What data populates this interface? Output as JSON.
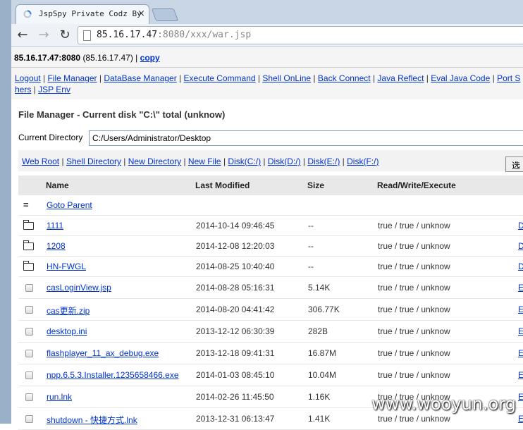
{
  "browser": {
    "tab_title": "JspSpy Private Codz By",
    "tab_close": "×",
    "url_host": "85.16.17.47",
    "url_rest": ":8080/xxx/war.jsp"
  },
  "header": {
    "host": "85.16.17.47:8080",
    "ip": "(85.16.17.47)",
    "sep": "|",
    "copy": "copy"
  },
  "menu": [
    "Logout",
    "File Manager",
    "DataBase Manager",
    "Execute Command",
    "Shell OnLine",
    "Back Connect",
    "Java Reflect",
    "Eval Java Code",
    "Port Scan",
    "Others",
    "JSP Env"
  ],
  "menu_display": {
    "portscan_line1": "Port S",
    "others_line2": "hers"
  },
  "file_manager": {
    "title": "File Manager - Current disk \"C:\\\" total (unknow)",
    "current_dir_label": "Current Directory",
    "current_dir_value": "C:/Users/Administrator/Desktop",
    "links": [
      "Web Root",
      "Shell Directory",
      "New Directory",
      "New File",
      "Disk(C:/)",
      "Disk(D:/)",
      "Disk(E:/)",
      "Disk(F:/)"
    ],
    "pick_button": "选",
    "columns": [
      "Name",
      "Last Modified",
      "Size",
      "Read/Write/Execute"
    ],
    "parent": {
      "icon": "=",
      "label": "Goto Parent"
    },
    "rows": [
      {
        "type": "folder",
        "name": "1111",
        "modified": "2014-10-14 09:46:45",
        "size": "--",
        "rwx": "true / true / unknow",
        "act": "D"
      },
      {
        "type": "folder",
        "name": "1208",
        "modified": "2014-12-08 12:20:03",
        "size": "--",
        "rwx": "true / true / unknow",
        "act": "D"
      },
      {
        "type": "folder",
        "name": "HN-FWGL",
        "modified": "2014-08-25 10:40:40",
        "size": "--",
        "rwx": "true / true / unknow",
        "act": "D"
      },
      {
        "type": "file",
        "name": "casLoginView.jsp",
        "modified": "2014-08-28 05:16:31",
        "size": "5.14K",
        "rwx": "true / true / unknow",
        "act": "E"
      },
      {
        "type": "file",
        "name": "cas更新.zip",
        "modified": "2014-08-20 04:41:42",
        "size": "306.77K",
        "rwx": "true / true / unknow",
        "act": "E"
      },
      {
        "type": "file",
        "name": "desktop.ini",
        "modified": "2013-12-12 06:30:39",
        "size": "282B",
        "rwx": "true / true / unknow",
        "act": "E"
      },
      {
        "type": "file",
        "name": "flashplayer_11_ax_debug.exe",
        "modified": "2013-12-18 09:41:31",
        "size": "16.87M",
        "rwx": "true / true / unknow",
        "act": "E"
      },
      {
        "type": "file",
        "name": "npp.6.5.3.Installer.1235658466.exe",
        "modified": "2014-01-03 08:45:10",
        "size": "10.04M",
        "rwx": "true / true / unknow",
        "act": "E"
      },
      {
        "type": "file",
        "name": "run.lnk",
        "modified": "2014-02-26 11:45:50",
        "size": "1.16K",
        "rwx": "true / true / unknow",
        "act": "E"
      },
      {
        "type": "file",
        "name": "shutdown - 快捷方式.lnk",
        "modified": "2013-12-31 06:13:47",
        "size": "1.41K",
        "rwx": "true / true / unknow",
        "act": "E"
      }
    ]
  },
  "watermark": "www.wooyun.org",
  "colors": {
    "link": "#0033cc",
    "chrome_tabstrip": "#c9d6e6",
    "page_bg": "#f5f5f5"
  }
}
